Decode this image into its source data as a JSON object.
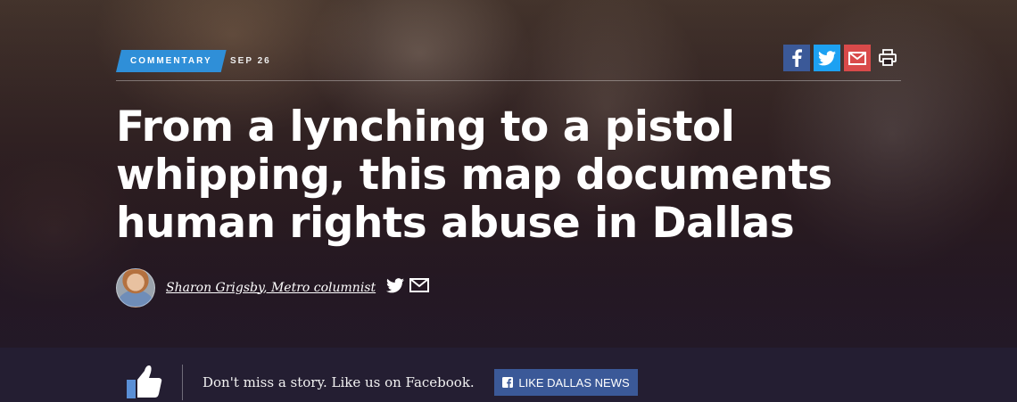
{
  "article": {
    "category": "COMMENTARY",
    "date": "SEP 26",
    "headline": "From a lynching to a pistol whipping, this map documents human rights abuse in Dallas",
    "author": "Sharon Grigsby, Metro columnist"
  },
  "share": {
    "icons": [
      "facebook-icon",
      "twitter-icon",
      "email-icon",
      "print-icon"
    ],
    "colors": {
      "facebook": "#3b5998",
      "twitter": "#1da1f2",
      "email": "#d94a4a"
    }
  },
  "byline_icons": [
    "twitter-icon",
    "email-icon"
  ],
  "promo_bar": {
    "text": "Don't miss a story. Like us on Facebook.",
    "button_label": "LIKE DALLAS NEWS",
    "button_color": "#3b5998",
    "icon": "thumbs-up-icon"
  },
  "colors": {
    "tag_blue": "#2f8fd8",
    "bar_background": "#241e32"
  }
}
